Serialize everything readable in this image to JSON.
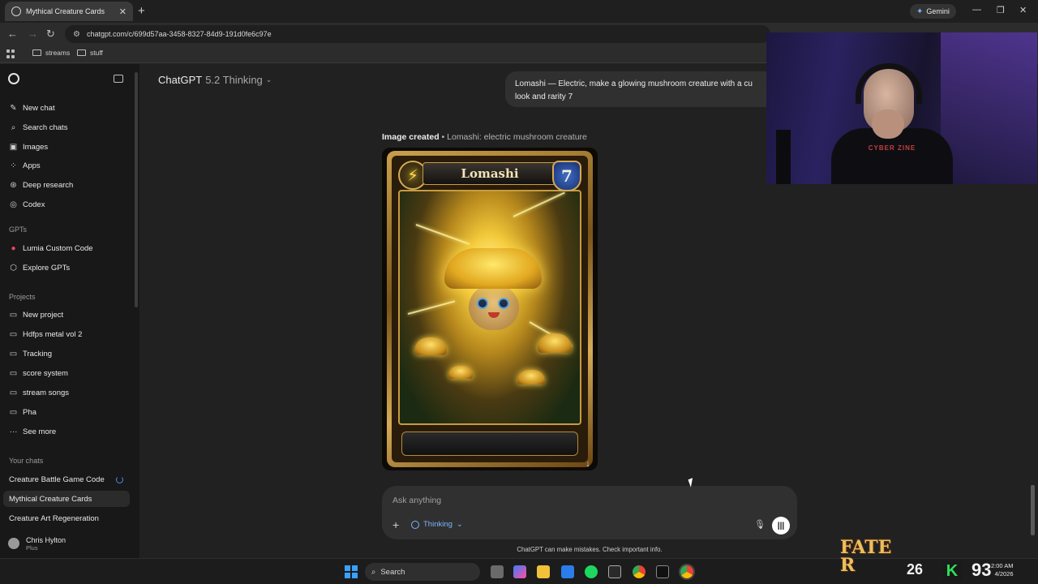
{
  "browser": {
    "tab_title": "Mythical Creature Cards",
    "new_tab": "+",
    "gemini_label": "Gemini",
    "url": "chatgpt.com/c/699d57aa-3458-8327-84d9-191d0fe6c97e",
    "bookmarks": [
      "streams",
      "stuff"
    ]
  },
  "sidebar": {
    "nav": [
      {
        "label": "New chat",
        "icon": "edit-icon"
      },
      {
        "label": "Search chats",
        "icon": "search-icon"
      },
      {
        "label": "Images",
        "icon": "image-icon"
      },
      {
        "label": "Apps",
        "icon": "apps-icon"
      },
      {
        "label": "Deep research",
        "icon": "research-icon"
      },
      {
        "label": "Codex",
        "icon": "codex-icon"
      }
    ],
    "gpts_heading": "GPTs",
    "gpts": [
      {
        "label": "Lumia Custom Code",
        "icon": "gpt-avatar-icon"
      },
      {
        "label": "Explore GPTs",
        "icon": "explore-icon"
      }
    ],
    "projects_heading": "Projects",
    "projects": [
      {
        "label": "New project",
        "icon": "folder-plus-icon"
      },
      {
        "label": "Hdfps metal vol 2",
        "icon": "folder-icon"
      },
      {
        "label": "Tracking",
        "icon": "folder-icon"
      },
      {
        "label": "score system",
        "icon": "folder-icon"
      },
      {
        "label": "stream songs",
        "icon": "folder-icon"
      },
      {
        "label": "Pha",
        "icon": "folder-icon"
      },
      {
        "label": "See more",
        "icon": "more-icon"
      }
    ],
    "chats_heading": "Your chats",
    "chats": [
      "Creature Battle Game Code",
      "Mythical Creature Cards",
      "Creature Art Regeneration"
    ],
    "profile": {
      "name": "Chris Hylton",
      "plan": "Plus"
    }
  },
  "main": {
    "model_name": "ChatGPT",
    "model_version": "5.2 Thinking",
    "user_message": "Lomashi — Electric, make a glowing mushroom creature with a cu look and rarity 7",
    "image_label_bold": "Image created",
    "image_label_rest": " • Lomashi: electric mushroom creature",
    "card": {
      "name": "Lomashi",
      "element": "Electric",
      "rarity": "7"
    },
    "composer": {
      "placeholder": "Ask anything",
      "mode": "Thinking"
    },
    "disclaimer": "ChatGPT can make mistakes. Check important info."
  },
  "webcam": {
    "shirt_text": "CYBER ZINE"
  },
  "taskbar": {
    "search_label": "Search",
    "overlay_logo": "FATE R",
    "tray_count_a": "26",
    "tray_count_b": "93",
    "clock_time": "2:00 AM",
    "clock_date": "4/2026"
  }
}
